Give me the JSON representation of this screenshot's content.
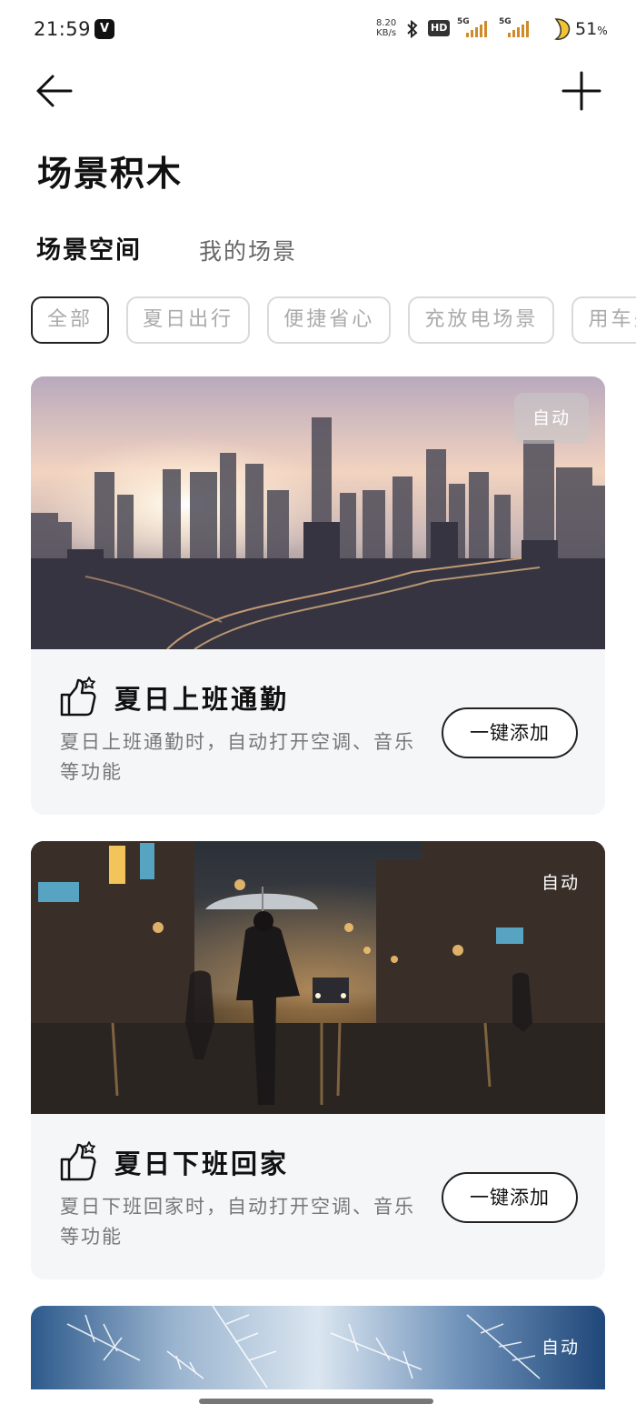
{
  "status_bar": {
    "time": "21:59",
    "app_icon_glyph": "V",
    "net_speed_value": "8.20",
    "net_speed_unit": "KB/s",
    "hd_badge": "HD",
    "signal_1_label": "5G",
    "signal_2_label": "5G",
    "battery_percent": "51",
    "battery_suffix": "%"
  },
  "header": {
    "back_icon": "arrow-left-icon",
    "add_icon": "plus-icon",
    "title": "场景积木"
  },
  "tabs": [
    {
      "label": "场景空间",
      "active": true
    },
    {
      "label": "我的场景",
      "active": false
    }
  ],
  "chips": [
    {
      "label": "全部",
      "active": true
    },
    {
      "label": "夏日出行",
      "active": false
    },
    {
      "label": "便捷省心",
      "active": false
    },
    {
      "label": "充放电场景",
      "active": false
    },
    {
      "label": "用车关",
      "active": false
    }
  ],
  "cards": [
    {
      "badge": "自动",
      "icon": "thumbs-up-star-icon",
      "title": "夏日上班通勤",
      "description": "夏日上班通勤时，自动打开空调、音乐等功能",
      "button": "一键添加",
      "image": "city-skyline-sunrise"
    },
    {
      "badge": "自动",
      "icon": "thumbs-up-star-icon",
      "title": "夏日下班回家",
      "description": "夏日下班回家时，自动打开空调、音乐等功能",
      "button": "一键添加",
      "image": "rainy-street-night"
    },
    {
      "badge": "自动",
      "image": "frost-crystals"
    }
  ],
  "colors": {
    "card_background": "#f5f6f8",
    "text_primary": "#111111",
    "text_secondary": "#777777",
    "chip_border": "#dadada"
  }
}
